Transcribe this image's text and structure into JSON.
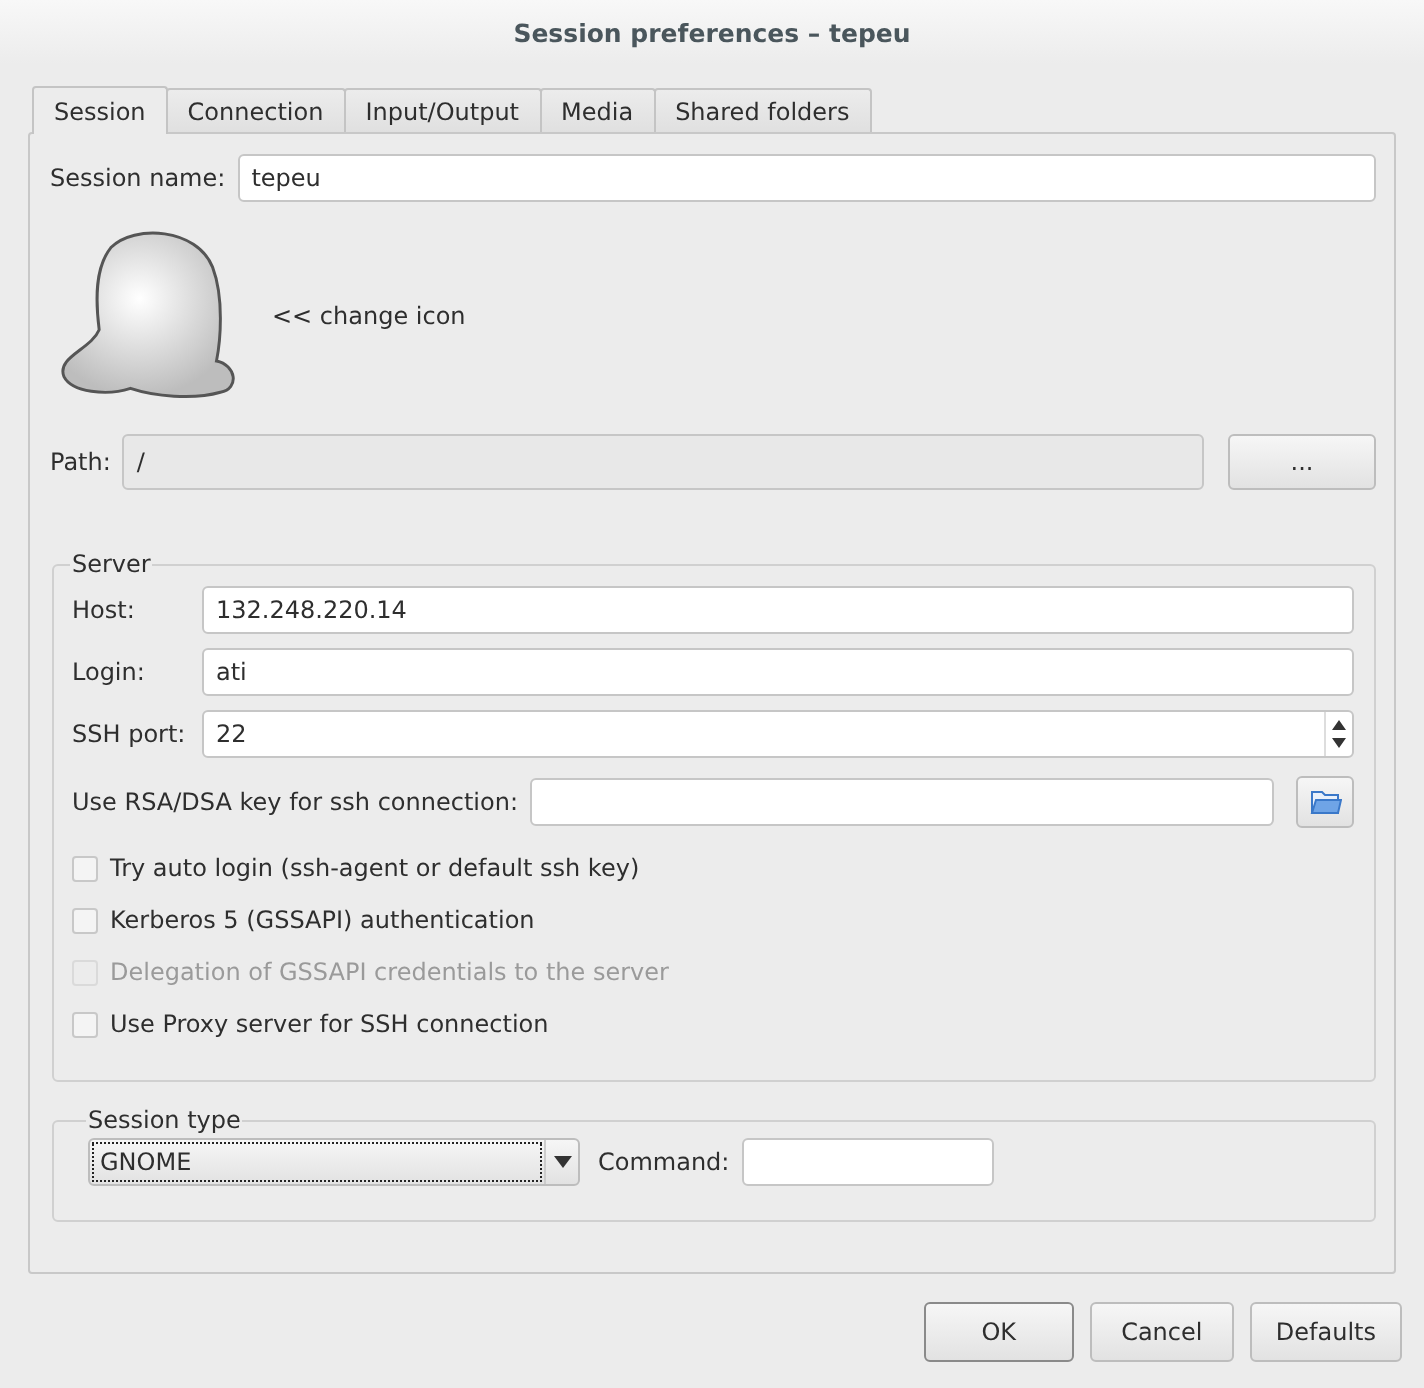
{
  "window": {
    "title": "Session preferences – tepeu"
  },
  "tabs": [
    {
      "label": "Session",
      "selected": true
    },
    {
      "label": "Connection",
      "selected": false
    },
    {
      "label": "Input/Output",
      "selected": false
    },
    {
      "label": "Media",
      "selected": false
    },
    {
      "label": "Shared folders",
      "selected": false
    }
  ],
  "session_name": {
    "label": "Session name:",
    "value": "tepeu"
  },
  "icon_button": {
    "label": "<< change icon"
  },
  "path": {
    "label": "Path:",
    "value": "/",
    "disabled": true,
    "browse_button": "..."
  },
  "server": {
    "title": "Server",
    "fields": [
      {
        "label": "Host:",
        "value": "132.248.220.14",
        "kind": "text"
      },
      {
        "label": "Login:",
        "value": "ati",
        "kind": "text"
      },
      {
        "label": "SSH port:",
        "value": "22",
        "kind": "spin"
      }
    ],
    "key": {
      "label": "Use RSA/DSA key for ssh connection:"
    },
    "options": [
      {
        "label": "Try auto login (ssh-agent or default ssh key)",
        "checked": false,
        "disabled": false
      },
      {
        "label": "Kerberos 5 (GSSAPI) authentication",
        "checked": false,
        "disabled": false
      },
      {
        "label": "Delegation of GSSAPI credentials to the server",
        "checked": false,
        "disabled": true
      },
      {
        "label": "Use Proxy server for SSH connection",
        "checked": false,
        "disabled": false
      }
    ]
  },
  "session_type": {
    "title": "Session type",
    "value": "GNOME",
    "command_label": "Command:"
  },
  "buttons": [
    {
      "label": "OK",
      "default": true
    },
    {
      "label": "Cancel",
      "default": false
    },
    {
      "label": "Defaults",
      "default": false
    }
  ]
}
